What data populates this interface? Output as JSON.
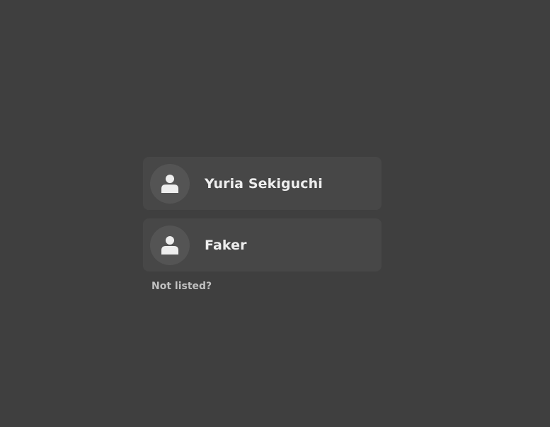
{
  "users": [
    {
      "name": "Yuria Sekiguchi",
      "icon": "user-avatar-icon"
    },
    {
      "name": "Faker",
      "icon": "user-avatar-icon"
    }
  ],
  "not_listed_label": "Not listed?",
  "colors": {
    "background": "#3f3f3f",
    "card": "#474747",
    "avatar": "#545454",
    "text": "#eeeeee",
    "link_text": "#c0c0c0"
  }
}
